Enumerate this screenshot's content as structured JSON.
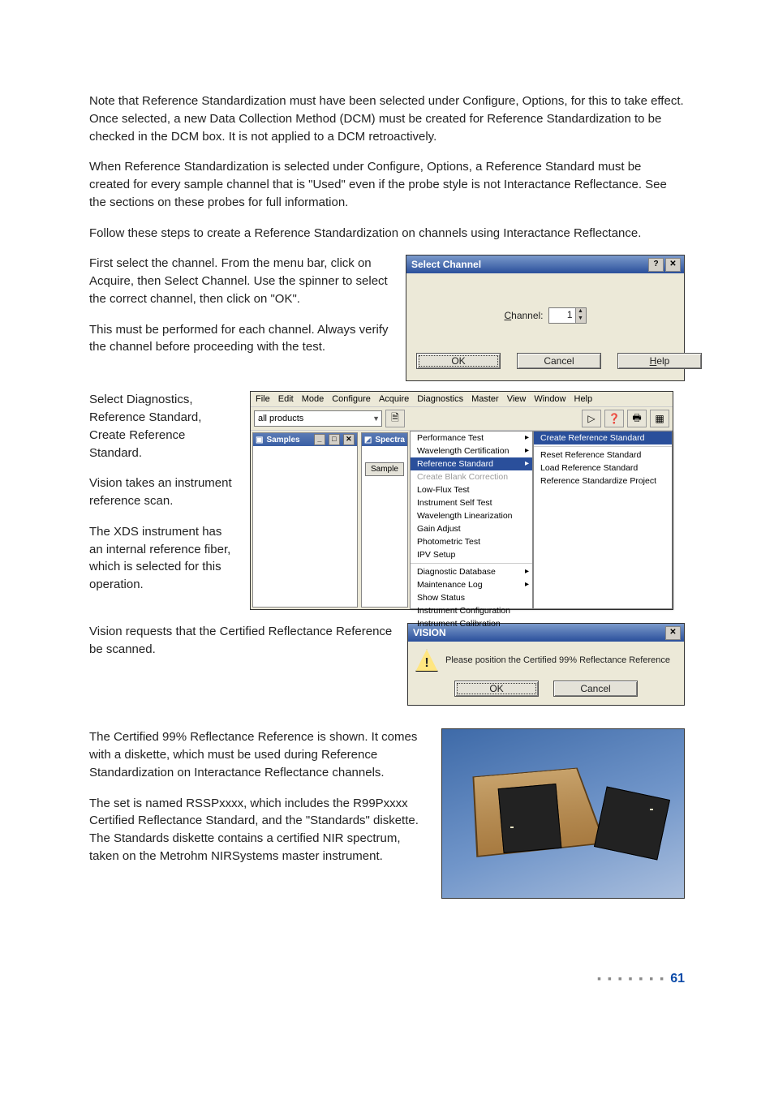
{
  "paragraphs": {
    "p1": "Note that Reference Standardization must have been selected under Configure, Options, for this to take effect. Once selected, a new Data Collection Method (DCM) must be created for Reference Standardization to be checked in the DCM box. It is not applied to a DCM retroactively.",
    "p2": "When Reference Standardization is selected under Configure, Options, a Reference Standard must be created for every sample channel that is \"Used\" even if the probe style is not Interactance Reflectance. See the sections on these probes for full information.",
    "p3": "Follow these steps to create a Reference Standardization on channels using Interactance Reflectance.",
    "p4": "First select the channel. From the menu bar, click on Acquire, then Select Channel. Use the spinner to select the correct channel, then click on \"OK\".",
    "p5": "This must be performed for each channel. Always verify the channel before proceeding with the test.",
    "p6": "Select Diagnostics, Reference Standard, Create Reference Standard.",
    "p7": "Vision takes an instrument reference scan.",
    "p8": "The XDS instrument has an internal reference fiber, which is selected for this operation.",
    "p9": "Vision requests that the Certified Reflectance Reference be scanned.",
    "p10": "The Certified 99% Reflectance Reference is shown. It comes with a diskette, which must be used during Reference Standardization on Interactance Reflectance channels.",
    "p11": "The set is named RSSPxxxx, which includes the R99Pxxxx Certified Reflectance Standard, and the \"Standards\" diskette. The Standards diskette contains a certified NIR spectrum, taken on the Metrohm NIRSystems master instrument."
  },
  "selectChannel": {
    "title": "Select Channel",
    "channelLabelPrefix": "C",
    "channelLabelRest": "hannel:",
    "value": "1",
    "ok": "OK",
    "cancel": "Cancel",
    "helpPrefix": "H",
    "helpRest": "elp"
  },
  "visionWindow": {
    "menubar": [
      "File",
      "Edit",
      "Mode",
      "Configure",
      "Acquire",
      "Diagnostics",
      "Master",
      "View",
      "Window",
      "Help"
    ],
    "combo": "all products",
    "panelSamplesTitle": "Samples",
    "panelSpectraTitle": "Spectra",
    "sampleBtn": "Sample",
    "diagMenu": [
      {
        "t": "Performance Test",
        "arrow": true
      },
      {
        "t": "Wavelength Certification",
        "arrow": true
      },
      {
        "t": "Reference Standard",
        "arrow": true,
        "sel": true
      },
      {
        "t": "Create Blank Correction",
        "disabled": true
      },
      {
        "t": "Low-Flux Test"
      },
      {
        "t": "Instrument Self Test"
      },
      {
        "t": "Wavelength Linearization"
      },
      {
        "t": "Gain Adjust"
      },
      {
        "t": "Photometric Test"
      },
      {
        "t": "IPV Setup"
      },
      {
        "sep": true
      },
      {
        "t": "Diagnostic Database",
        "arrow": true
      },
      {
        "t": "Maintenance Log",
        "arrow": true
      },
      {
        "t": "Show Status"
      },
      {
        "t": "Instrument Configuration"
      },
      {
        "t": "Instrument Calibration"
      }
    ],
    "refSubmenu": [
      {
        "t": "Create Reference Standard",
        "sel": true
      },
      {
        "sep": true
      },
      {
        "t": "Reset Reference Standard"
      },
      {
        "t": "Load Reference Standard"
      },
      {
        "t": "Reference Standardize Project"
      }
    ]
  },
  "msgbox": {
    "title": "VISION",
    "text": "Please position the Certified 99% Reflectance Reference",
    "ok": "OK",
    "cancel": "Cancel"
  },
  "footer": {
    "dots": "▪ ▪ ▪ ▪ ▪ ▪ ▪",
    "page": "61"
  }
}
